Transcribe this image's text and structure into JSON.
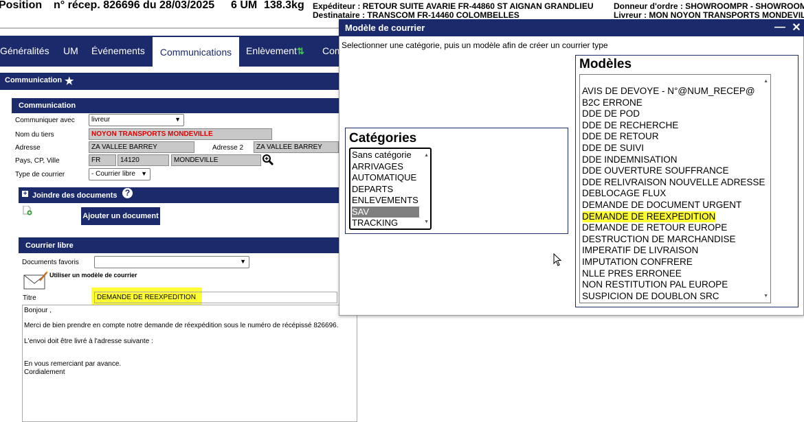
{
  "header": {
    "position_label": "Position",
    "recep_label": "n° récep. 826696 du 28/03/2025",
    "um_label": "6 UM",
    "weight_label": "138.3kg",
    "expediteur": "Expéditeur : RETOUR SUITE AVARIE FR-44860 ST AIGNAN GRANDLIEU",
    "destinataire": "Destinataire : TRANSCOM FR-14460 COLOMBELLES",
    "donneur": "Donneur d'ordre : SHOWROOMPR - SHOWROOM",
    "livreur": "Livreur : MON NOYON TRANSPORTS MONDEVILLE"
  },
  "tabs": [
    {
      "label": "Généralités"
    },
    {
      "label": "UM"
    },
    {
      "label": "Événements"
    },
    {
      "label": "Communications"
    },
    {
      "label": "Enlèvement"
    },
    {
      "label": "Com"
    }
  ],
  "communication_section": {
    "title": "Communication",
    "subtitle": "Communication",
    "communiquer_label": "Communiquer avec",
    "communiquer_value": "livreur",
    "nom_label": "Nom du tiers",
    "nom_value": "NOYON TRANSPORTS MONDEVILLE",
    "adresse_label": "Adresse",
    "adresse_value": "ZA VALLEE BARREY",
    "adresse2_label": "Adresse 2",
    "adresse2_value": "ZA VALLEE BARREY",
    "pays_label": "Pays, CP, Ville",
    "pays_value": "FR",
    "cp_value": "14120",
    "ville_value": "MONDEVILLE",
    "type_label": "Type de courrier",
    "type_value": "- Courrier libre"
  },
  "joindre": {
    "title": "Joindre des documents",
    "ajouter_label": "Ajouter un document"
  },
  "courrier_libre": {
    "title": "Courrier libre",
    "favoris_label": "Documents favoris",
    "favoris_value": "",
    "modele_label": "Utiliser un modèle de courrier",
    "titre_label": "Titre",
    "titre_value": "DEMANDE DE REEXPEDITION",
    "body_lines": [
      "Bonjour ,",
      "",
      "Merci de bien prendre en compte notre demande de réexpédition sous le numéro de récépissé 826696.",
      "",
      "L'envoi doit être livré à l'adresse suivante :",
      "",
      "",
      "En vous remerciant par avance.",
      "Cordialement"
    ]
  },
  "dialog": {
    "title": "Modèle de courrier",
    "instruction": "Selectionner une catégorie, puis un modèle afin de créer un courrier type",
    "categories_title": "Catégories",
    "categories": [
      "Sans catégorie",
      "ARRIVAGES",
      "AUTOMATIQUE",
      "DEPARTS",
      "ENLEVEMENTS",
      "SAV",
      "TRACKING"
    ],
    "selected_category": "SAV",
    "modeles_title": "Modèles",
    "modeles": [
      "AVIS DE DEVOYE - N°@NUM_RECEP@",
      "B2C ERRONE",
      "DDE DE POD",
      "DDE DE RECHERCHE",
      "DDE DE RETOUR",
      "DDE DE SUIVI",
      "DDE INDEMNISATION",
      "DDE OUVERTURE SOUFFRANCE",
      "DDE RELIVRAISON NOUVELLE ADRESSE",
      "DEBLOCAGE FLUX",
      "DEMANDE DE DOCUMENT URGENT",
      "DEMANDE DE REEXPEDITION",
      "DEMANDE DE RETOUR EUROPE",
      "DESTRUCTION DE MARCHANDISE",
      "IMPERATIF DE LIVRAISON",
      "IMPUTATION CONFRERE",
      "NLLE PRES ERRONEE",
      "NON RESTITUTION PAL EUROPE",
      "SUSPICION DE DOUBLON SRC"
    ],
    "highlighted_modele": "DEMANDE DE REEXPEDITION"
  },
  "colors": {
    "nav_blue": "#1b2a6b",
    "highlight_yellow": "#ffff33",
    "selected_gray": "#808080",
    "error_red": "#e00000"
  }
}
